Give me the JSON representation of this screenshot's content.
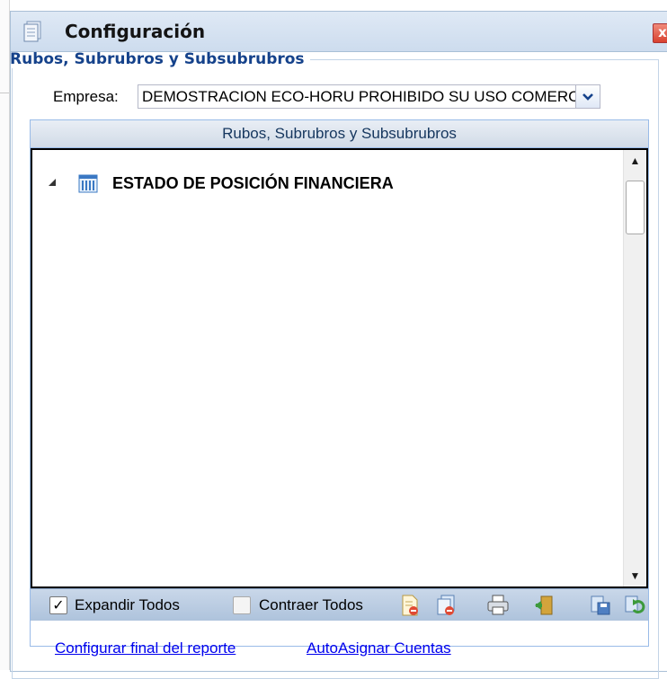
{
  "window": {
    "title": "Configuración",
    "close_glyph": "x",
    "title_icon": "document-stack-icon",
    "colors": {
      "title_bar": "#cddcee",
      "accent": "#15428b",
      "close": "#d8412f"
    }
  },
  "fieldset": {
    "legend": "Rubos, Subrubros y Subsubrubros"
  },
  "empresa": {
    "label": "Empresa:",
    "value": "DEMOSTRACION ECO-HORU PROHIBIDO SU USO COMERCIAL"
  },
  "tree": {
    "header": "Rubos, Subrubros y Subsubrubros",
    "nodes": [
      {
        "label": "ESTADO DE POSICIÓN FINANCIERA",
        "expanded": true,
        "icon": "bank-building-icon"
      }
    ],
    "scroll_up": "▲",
    "scroll_down": "▼"
  },
  "toolbar": {
    "expand_checked_glyph": "✓",
    "expand_label": "Expandir Todos",
    "expand_checked": true,
    "collapse_label": "Contraer Todos",
    "collapse_checked": false,
    "buttons": [
      "delete-document-icon",
      "delete-copy-icon",
      "print-icon",
      "exit-door-icon",
      "save-copy-icon",
      "refresh-icon"
    ]
  },
  "links": {
    "configure_end": "Configurar final del reporte",
    "auto_assign": "AutoAsignar Cuentas"
  }
}
